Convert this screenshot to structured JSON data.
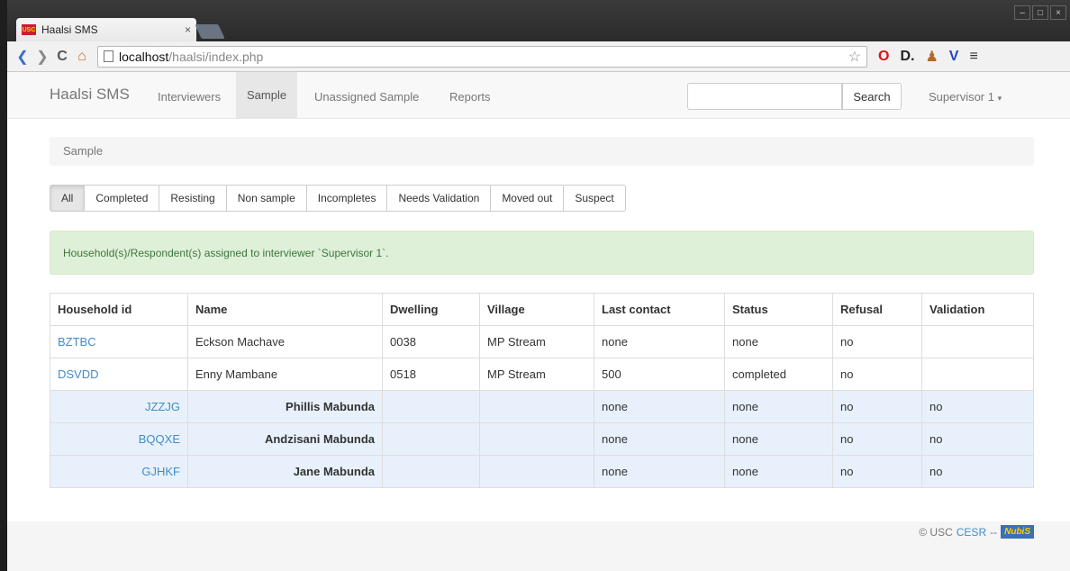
{
  "browser": {
    "tab_title": "Haalsi SMS",
    "tab_close": "×",
    "url_host": "localhost",
    "url_path": "/haalsi/index.php"
  },
  "navbar": {
    "brand": "Haalsi SMS",
    "links": [
      "Interviewers",
      "Sample",
      "Unassigned Sample",
      "Reports"
    ],
    "active": "Sample",
    "search_button": "Search",
    "search_value": "",
    "user": "Supervisor 1"
  },
  "breadcrumb": "Sample",
  "filters": [
    "All",
    "Completed",
    "Resisting",
    "Non sample",
    "Incompletes",
    "Needs Validation",
    "Moved out",
    "Suspect"
  ],
  "alert": "Household(s)/Respondent(s) assigned to interviewer `Supervisor 1`.",
  "table": {
    "headers": [
      "Household id",
      "Name",
      "Dwelling",
      "Village",
      "Last contact",
      "Status",
      "Refusal",
      "Validation"
    ],
    "rows": [
      [
        "BZTBC",
        "Eckson Machave",
        "0038",
        "MP Stream",
        "none",
        "none",
        "no",
        ""
      ],
      [
        "DSVDD",
        "Enny Mambane",
        "0518",
        "MP Stream",
        "500",
        "completed",
        "no",
        ""
      ],
      [
        "JZZJG",
        "Phillis Mabunda",
        "",
        "",
        "none",
        "none",
        "no",
        "no"
      ],
      [
        "BQQXE",
        "Andzisani Mabunda",
        "",
        "",
        "none",
        "none",
        "no",
        "no"
      ],
      [
        "GJHKF",
        "Jane Mabunda",
        "",
        "",
        "none",
        "none",
        "no",
        "no"
      ]
    ]
  },
  "footer": {
    "prefix": "© USC",
    "link": "CESR",
    "sep": "--",
    "logo": "NubiS"
  }
}
